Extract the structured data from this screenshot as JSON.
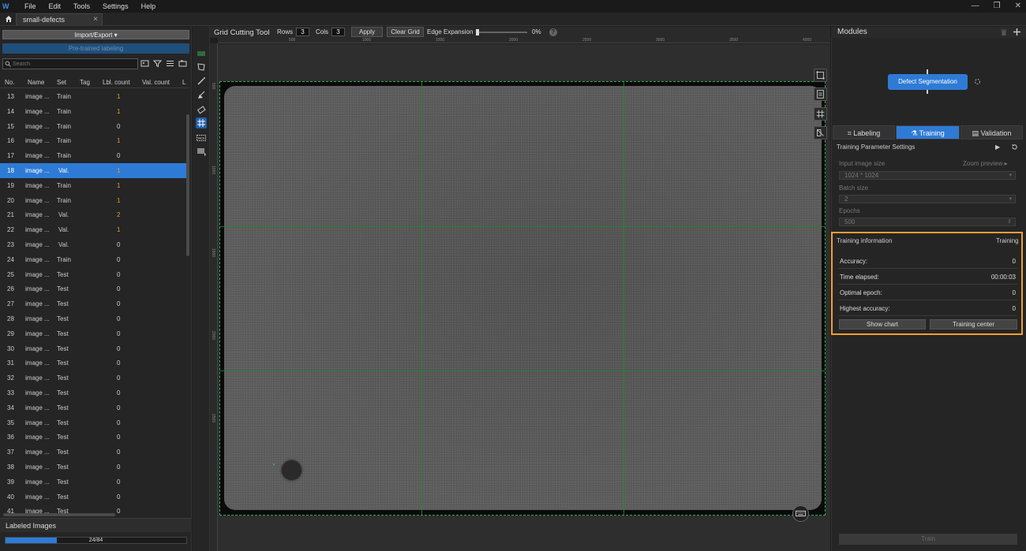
{
  "app": {
    "menus": [
      "File",
      "Edit",
      "Tools",
      "Settings",
      "Help"
    ],
    "document_tab": "small-defects",
    "close_glyph": "×",
    "window_controls": [
      "—",
      "❐",
      "✕"
    ]
  },
  "left": {
    "import_label": "Import/Export ▾",
    "pretrained_label": "Pre-trained labeling",
    "search_placeholder": "Search",
    "columns": [
      "No.",
      "Name",
      "Set",
      "Tag",
      "Lbl. count",
      "Val. count",
      "L"
    ],
    "rows": [
      {
        "no": "13",
        "name": "image ...",
        "set": "Train",
        "lbl": "1",
        "lbl_color": "#e0a020"
      },
      {
        "no": "14",
        "name": "image ...",
        "set": "Train",
        "lbl": "1",
        "lbl_color": "#e0a020"
      },
      {
        "no": "15",
        "name": "image ...",
        "set": "Train",
        "lbl": "0",
        "lbl_color": "#cccccc"
      },
      {
        "no": "16",
        "name": "image ...",
        "set": "Train",
        "lbl": "1",
        "lbl_color": "#e0a020"
      },
      {
        "no": "17",
        "name": "image ...",
        "set": "Train",
        "lbl": "0",
        "lbl_color": "#cccccc"
      },
      {
        "no": "18",
        "name": "image ...",
        "set": "Val.",
        "lbl": "1",
        "lbl_color": "#e0a020",
        "selected": true
      },
      {
        "no": "19",
        "name": "image ...",
        "set": "Train",
        "lbl": "1",
        "lbl_color": "#e0a020"
      },
      {
        "no": "20",
        "name": "image ...",
        "set": "Train",
        "lbl": "1",
        "lbl_color": "#e0a020"
      },
      {
        "no": "21",
        "name": "image ...",
        "set": "Val.",
        "lbl": "2",
        "lbl_color": "#e0a020"
      },
      {
        "no": "22",
        "name": "image ...",
        "set": "Val.",
        "lbl": "1",
        "lbl_color": "#e0a020"
      },
      {
        "no": "23",
        "name": "image ...",
        "set": "Val.",
        "lbl": "0",
        "lbl_color": "#cccccc"
      },
      {
        "no": "24",
        "name": "image ...",
        "set": "Train",
        "lbl": "0",
        "lbl_color": "#cccccc"
      },
      {
        "no": "25",
        "name": "image ...",
        "set": "Test",
        "lbl": "0",
        "lbl_color": "#cccccc"
      },
      {
        "no": "26",
        "name": "image ...",
        "set": "Test",
        "lbl": "0",
        "lbl_color": "#cccccc"
      },
      {
        "no": "27",
        "name": "image ...",
        "set": "Test",
        "lbl": "0",
        "lbl_color": "#cccccc"
      },
      {
        "no": "28",
        "name": "image ...",
        "set": "Test",
        "lbl": "0",
        "lbl_color": "#cccccc"
      },
      {
        "no": "29",
        "name": "image ...",
        "set": "Test",
        "lbl": "0",
        "lbl_color": "#cccccc"
      },
      {
        "no": "30",
        "name": "image ...",
        "set": "Test",
        "lbl": "0",
        "lbl_color": "#cccccc"
      },
      {
        "no": "31",
        "name": "image ...",
        "set": "Test",
        "lbl": "0",
        "lbl_color": "#cccccc"
      },
      {
        "no": "32",
        "name": "image ...",
        "set": "Test",
        "lbl": "0",
        "lbl_color": "#cccccc"
      },
      {
        "no": "33",
        "name": "image ...",
        "set": "Test",
        "lbl": "0",
        "lbl_color": "#cccccc"
      },
      {
        "no": "34",
        "name": "image ...",
        "set": "Test",
        "lbl": "0",
        "lbl_color": "#cccccc"
      },
      {
        "no": "35",
        "name": "image ...",
        "set": "Test",
        "lbl": "0",
        "lbl_color": "#cccccc"
      },
      {
        "no": "36",
        "name": "image ...",
        "set": "Test",
        "lbl": "0",
        "lbl_color": "#cccccc"
      },
      {
        "no": "37",
        "name": "image ...",
        "set": "Test",
        "lbl": "0",
        "lbl_color": "#cccccc"
      },
      {
        "no": "38",
        "name": "image ...",
        "set": "Test",
        "lbl": "0",
        "lbl_color": "#cccccc"
      },
      {
        "no": "39",
        "name": "image ...",
        "set": "Test",
        "lbl": "0",
        "lbl_color": "#cccccc"
      },
      {
        "no": "40",
        "name": "image ...",
        "set": "Test",
        "lbl": "0",
        "lbl_color": "#cccccc"
      },
      {
        "no": "41",
        "name": "image ...",
        "set": "Test",
        "lbl": "0",
        "lbl_color": "#cccccc"
      }
    ],
    "labeled_title": "Labeled Images",
    "labeled_count": "24/84",
    "labeled_fraction": 0.2857
  },
  "canvas_toolbar": {
    "tool_name": "Grid Cutting Tool",
    "rows_label": "Rows",
    "rows_value": "3",
    "cols_label": "Cols",
    "cols_value": "3",
    "apply_label": "Apply",
    "clear_label": "Clear Grid",
    "edge_label": "Edge Expansion",
    "edge_value": "0%",
    "help_glyph": "?"
  },
  "rulers": {
    "h_ticks": [
      "500",
      "1000",
      "1500",
      "2000",
      "2500",
      "3000",
      "3500",
      "4000"
    ],
    "v_ticks": [
      "500",
      "1000",
      "1500",
      "2000",
      "2500"
    ]
  },
  "grid": {
    "rows": 3,
    "cols": 3
  },
  "right": {
    "modules_title": "Modules",
    "module_name": "Defect Segmentation",
    "tabs": [
      "Labeling",
      "Training",
      "Validation"
    ],
    "active_tab": "Training",
    "param_title": "Training Parameter Settings",
    "input_size_label": "Input image size",
    "zoom_preview": "Zoom preview ▸",
    "input_size_value": "1024 * 1024",
    "batch_label": "Batch size",
    "batch_value": "2",
    "epochs_label": "Epochs",
    "epochs_value": "500",
    "info_title": "Training information",
    "info_status": "Training",
    "info_rows": [
      {
        "k": "Accuracy:",
        "v": "0"
      },
      {
        "k": "Time elapsed:",
        "v": "00:00:03"
      },
      {
        "k": "Optimal epoch:",
        "v": "0"
      },
      {
        "k": "Highest accuracy:",
        "v": "0"
      }
    ],
    "show_chart": "Show chart",
    "training_center": "Training center",
    "train_button": "Train"
  },
  "colors": {
    "accent": "#2e7bd6",
    "highlight": "#f0a030",
    "grid": "#1e8a2e",
    "count_nonzero": "#e0a020"
  },
  "icons": [
    "home-icon",
    "search-icon",
    "grid-cut-icon",
    "keyboard-icon",
    "reset-icon",
    "delete-icon",
    "add-icon"
  ]
}
